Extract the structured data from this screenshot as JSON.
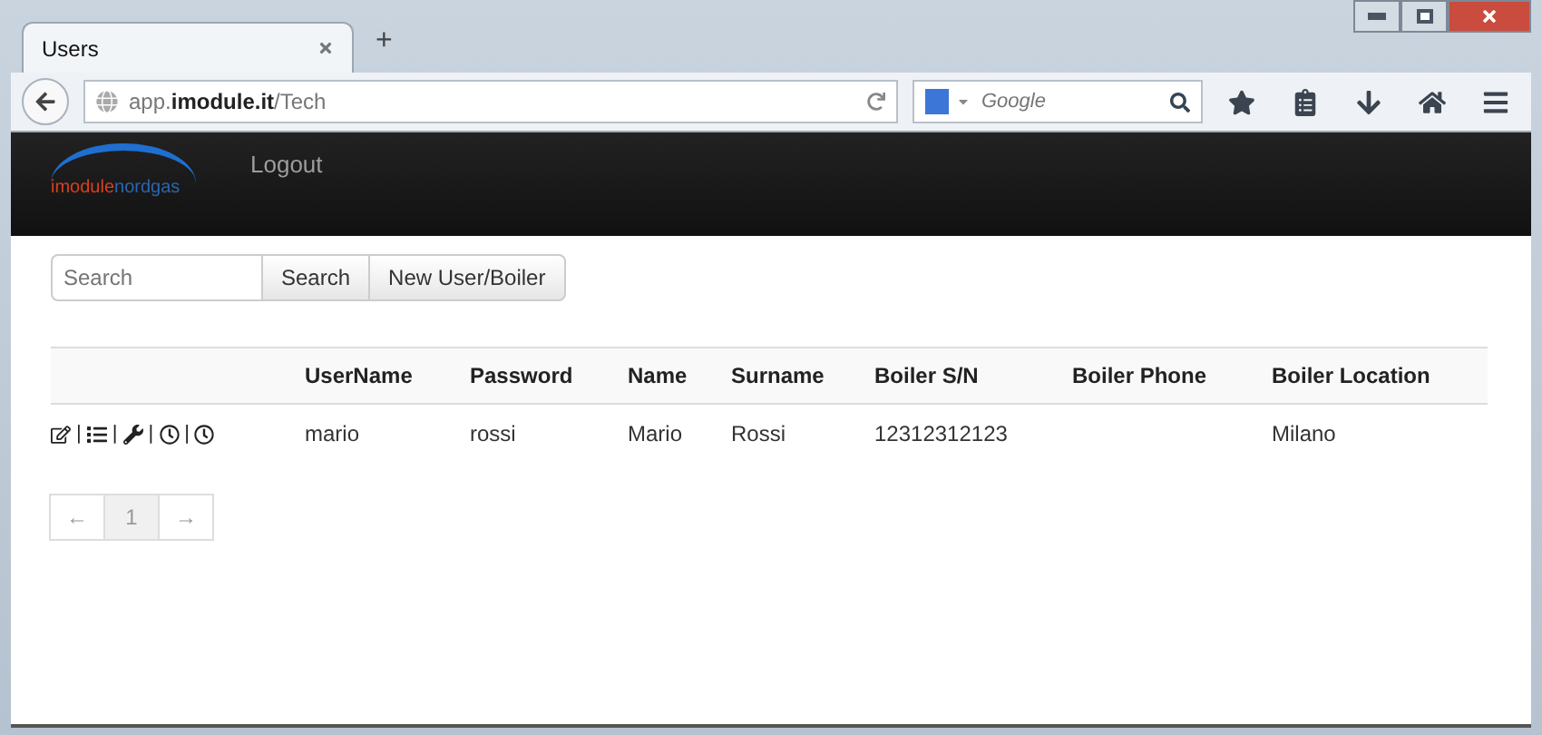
{
  "tabs": [
    {
      "label": "Users",
      "selected": true
    }
  ],
  "new_tab": "+",
  "address": "app.**imodule.it**/Tech",
  "search_engine": {
    "placeholder": "Google"
  },
  "logo": [
    {
      "text": "imodule",
      "color": "#d8401e"
    },
    {
      "text": "nordgas",
      "color": "#2a66b0"
    }
  ],
  "nav": [
    "Logout"
  ],
  "search": {
    "placeholder": "Search"
  },
  "buttons": [
    "Search",
    "New User/Boiler"
  ],
  "table": {
    "columns": [
      "UserName",
      "Password",
      "Name",
      "Surname",
      "Boiler S/N",
      "Boiler Phone",
      "Boiler Location"
    ],
    "rows": [
      {
        "actions": [
          {
            "kind": "edit"
          },
          {
            "kind": "list"
          },
          {
            "kind": "wrench"
          },
          {
            "kind": "clock"
          },
          {
            "kind": "clock"
          }
        ],
        "separator": "|",
        "cells": [
          "mario",
          "rossi",
          "Mario",
          "Rossi",
          "12312312123",
          "",
          "Milano"
        ]
      }
    ]
  },
  "pagination": [
    {
      "label": "←",
      "selected": false
    },
    {
      "label": "1",
      "selected": true
    },
    {
      "label": "→",
      "selected": false
    }
  ]
}
